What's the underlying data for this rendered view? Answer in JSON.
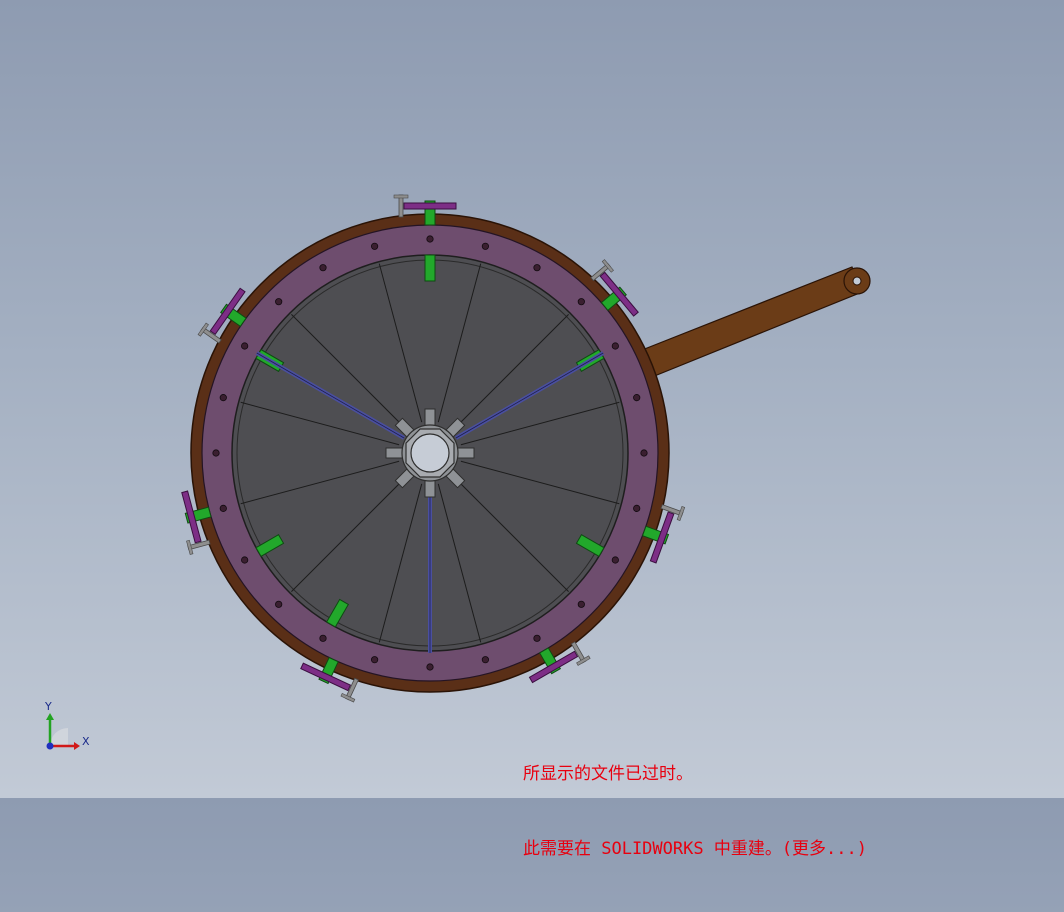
{
  "triad": {
    "x_label": "X",
    "y_label": "Y",
    "x_color": "#d11919",
    "y_color": "#22a322",
    "z_color": "#1f2fbf"
  },
  "warning": {
    "line1": "所显示的文件已过时。",
    "line2": "此需要在 SOLIDWORKS 中重建。(更多...)",
    "color": "#e8000f"
  },
  "model": {
    "colors": {
      "outer_rim": "#5a2f17",
      "flange": "#6e4d6e",
      "disc": "#4e4e52",
      "spoke": "#4a4fa0",
      "clamp_green": "#22a82b",
      "clamp_purple": "#7d2e86",
      "bolt_gray": "#8e8e8e",
      "handle": "#6b3c17"
    }
  }
}
